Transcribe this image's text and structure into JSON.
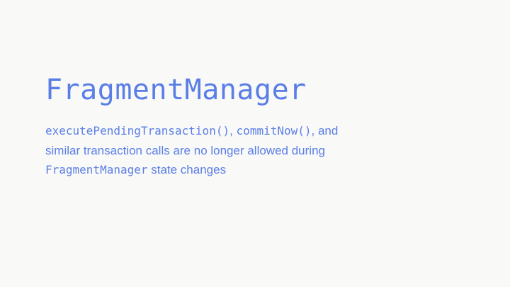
{
  "slide": {
    "title": "FragmentManager",
    "body": {
      "line1": {
        "code1": "executePendingTransaction()",
        "sep1": ", ",
        "code2": "commitNow()",
        "text": ", and"
      },
      "line2": {
        "text": "similar transaction calls are no longer allowed during"
      },
      "line3": {
        "code": "FragmentManager",
        "text": " state changes"
      }
    },
    "colors": {
      "accent": "#5a7ee6",
      "background": "#f9f9f8"
    }
  }
}
